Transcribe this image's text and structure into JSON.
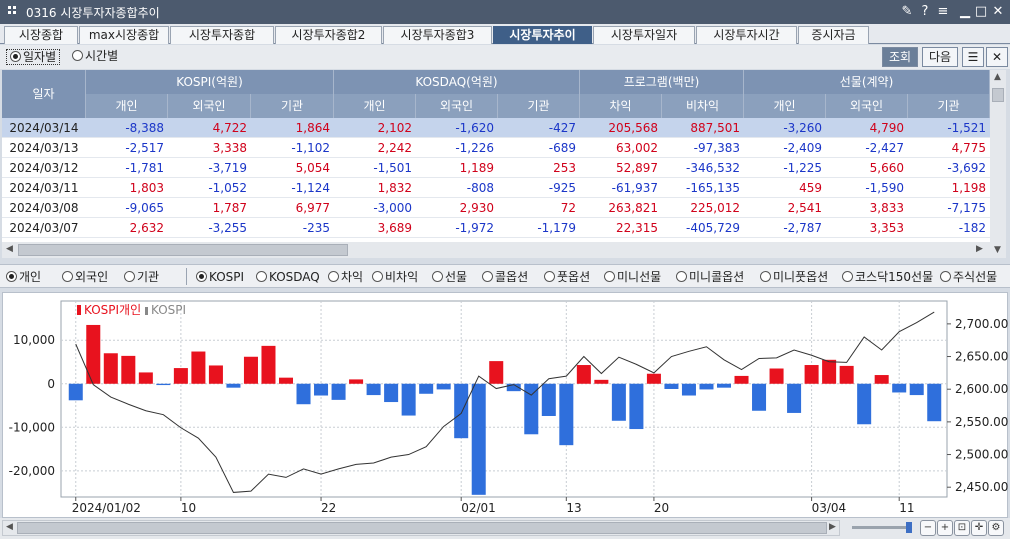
{
  "window": {
    "title": "0316 시장투자자종합추이"
  },
  "tabs": [
    {
      "label": "시장종합",
      "active": false
    },
    {
      "label": "max시장종합",
      "active": false
    },
    {
      "label": "시장투자종합",
      "active": false
    },
    {
      "label": "시장투자종합2",
      "active": false
    },
    {
      "label": "시장투자종합3",
      "active": false
    },
    {
      "label": "시장투자추이",
      "active": true
    },
    {
      "label": "시장투자일자",
      "active": false
    },
    {
      "label": "시장투자시간",
      "active": false
    },
    {
      "label": "증시자금",
      "active": false
    }
  ],
  "controls": {
    "radio_daily": "일자별",
    "radio_time": "시간별",
    "query_button": "조회",
    "next_button": "다음"
  },
  "grid": {
    "date_header": "일자",
    "groups": [
      "KOSPI(억원)",
      "KOSDAQ(억원)",
      "프로그램(백만)",
      "선물(계약)"
    ],
    "subheaders": [
      "개인",
      "외국인",
      "기관",
      "개인",
      "외국인",
      "기관",
      "차익",
      "비차익",
      "개인",
      "외국인",
      "기관"
    ],
    "rows": [
      {
        "date": "2024/03/14",
        "cells": [
          "-8,388",
          "4,722",
          "1,864",
          "2,102",
          "-1,620",
          "-427",
          "205,568",
          "887,501",
          "-3,260",
          "4,790",
          "-1,521"
        ]
      },
      {
        "date": "2024/03/13",
        "cells": [
          "-2,517",
          "3,338",
          "-1,102",
          "2,242",
          "-1,226",
          "-689",
          "63,002",
          "-97,383",
          "-2,409",
          "-2,427",
          "4,775"
        ]
      },
      {
        "date": "2024/03/12",
        "cells": [
          "-1,781",
          "-3,719",
          "5,054",
          "-1,501",
          "1,189",
          "253",
          "52,897",
          "-346,532",
          "-1,225",
          "5,660",
          "-3,692"
        ]
      },
      {
        "date": "2024/03/11",
        "cells": [
          "1,803",
          "-1,052",
          "-1,124",
          "1,832",
          "-808",
          "-925",
          "-61,937",
          "-165,135",
          "459",
          "-1,590",
          "1,198"
        ]
      },
      {
        "date": "2024/03/08",
        "cells": [
          "-9,065",
          "1,787",
          "6,977",
          "-3,000",
          "2,930",
          "72",
          "263,821",
          "225,012",
          "2,541",
          "3,833",
          "-7,175"
        ]
      },
      {
        "date": "2024/03/07",
        "cells": [
          "2,632",
          "-3,255",
          "-235",
          "3,689",
          "-1,972",
          "-1,179",
          "22,315",
          "-405,729",
          "-2,787",
          "3,353",
          "-182"
        ]
      }
    ]
  },
  "filters": {
    "investor": [
      "개인",
      "외국인",
      "기관"
    ],
    "investor_selected": "개인",
    "markets": [
      "KOSPI",
      "KOSDAQ",
      "차익",
      "비차익",
      "선물",
      "콜옵션",
      "풋옵션",
      "미니선물",
      "미니콜옵션",
      "미니풋옵션",
      "코스닥150선물",
      "주식선물"
    ],
    "market_selected": "KOSPI"
  },
  "colors": {
    "up": "#e8121e",
    "down": "#2f6fdc",
    "line": "#333333",
    "header": "#7d93b3",
    "selected_tab": "#3f5f88"
  },
  "chart_data": {
    "type": "bar",
    "legend": [
      "KOSPI개인",
      "KOSPI"
    ],
    "y_left": {
      "ticks": [
        10000,
        0,
        -10000,
        -20000
      ],
      "tick_labels": [
        "10,000",
        "0",
        "-10,000",
        "-20,000"
      ],
      "range": [
        -26000,
        19000
      ]
    },
    "y_right": {
      "ticks": [
        2700,
        2650,
        2600,
        2550,
        2500,
        2450
      ],
      "tick_labels": [
        "2,700.00",
        "2,650.00",
        "2,600.00",
        "2,550.00",
        "2,500.00",
        "2,450.00"
      ],
      "range": [
        2435,
        2735
      ]
    },
    "x_labels": [
      {
        "index": 0,
        "label": "2024/01/02"
      },
      {
        "index": 6,
        "label": "10"
      },
      {
        "index": 14,
        "label": "22"
      },
      {
        "index": 22,
        "label": "02/01"
      },
      {
        "index": 28,
        "label": "13"
      },
      {
        "index": 33,
        "label": "20"
      },
      {
        "index": 42,
        "label": "03/04"
      },
      {
        "index": 47,
        "label": "11"
      }
    ],
    "bars": [
      -3800,
      13500,
      7000,
      6400,
      2600,
      -300,
      3600,
      7400,
      4200,
      -900,
      6200,
      8700,
      1400,
      -4700,
      -2700,
      -3700,
      1000,
      -2600,
      -4200,
      -7300,
      -2300,
      -1300,
      -12500,
      -25500,
      5200,
      -1700,
      -11600,
      -7400,
      -14100,
      4300,
      900,
      -8500,
      -10400,
      2300,
      -1200,
      -2700,
      -1300,
      -900,
      1800,
      -6200,
      3500,
      -6700,
      4300,
      5500,
      4100,
      -9300,
      2000,
      -2000,
      -2600,
      -8600
    ],
    "kospi": [
      2669,
      2607,
      2588,
      2577,
      2567,
      2561,
      2541,
      2525,
      2496,
      2442,
      2444,
      2470,
      2465,
      2478,
      2470,
      2478,
      2485,
      2487,
      2496,
      2500,
      2512,
      2543,
      2563,
      2620,
      2601,
      2607,
      2591,
      2616,
      2620,
      2650,
      2624,
      2649,
      2638,
      2625,
      2650,
      2658,
      2665,
      2645,
      2630,
      2647,
      2648,
      2660,
      2652,
      2642,
      2641,
      2680,
      2660,
      2688,
      2702,
      2718
    ]
  },
  "chart_ui": {
    "scroll_label": "",
    "zoom_icons": [
      "zoom-out-icon",
      "zoom-in-icon",
      "zoom-fit-icon",
      "crosshair-icon",
      "settings-icon"
    ]
  }
}
